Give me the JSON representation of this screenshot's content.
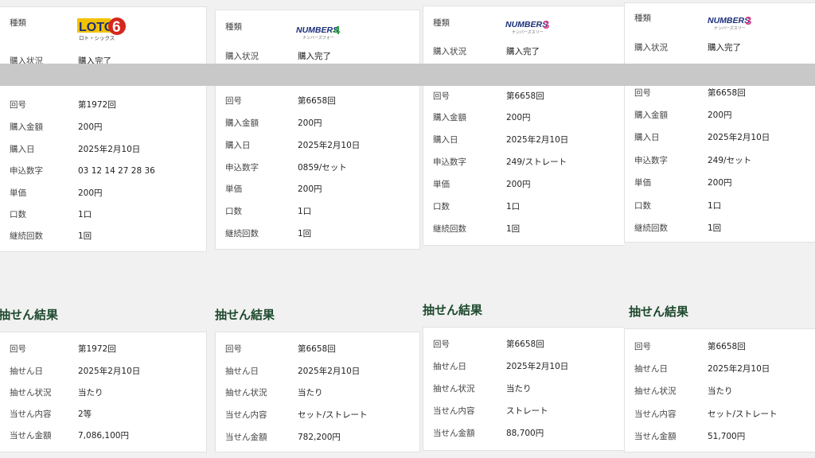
{
  "purchase_cards": [
    {
      "type_label": "種類",
      "logo": {
        "main": "LOTO",
        "num": "6",
        "sub": "ロト・シックス"
      },
      "status_label": "購入状況",
      "status_value": "購入完了",
      "rows": [
        {
          "label": "回号",
          "value": "第1972回"
        },
        {
          "label": "購入金額",
          "value": "200円"
        },
        {
          "label": "購入日",
          "value": "2025年2月10日"
        },
        {
          "label": "申込数字",
          "value": "03 12 14 27 28 36"
        },
        {
          "label": "単価",
          "value": "200円"
        },
        {
          "label": "口数",
          "value": "1口"
        },
        {
          "label": "継続回数",
          "value": "1回"
        }
      ]
    },
    {
      "type_label": "種類",
      "logo": {
        "main": "NUMBERS",
        "num": "4",
        "sub": "ナンバーズフォー"
      },
      "status_label": "購入状況",
      "status_value": "購入完了",
      "rows": [
        {
          "label": "回号",
          "value": "第6658回"
        },
        {
          "label": "購入金額",
          "value": "200円"
        },
        {
          "label": "購入日",
          "value": "2025年2月10日"
        },
        {
          "label": "申込数字",
          "value": "0859/セット"
        },
        {
          "label": "単価",
          "value": "200円"
        },
        {
          "label": "口数",
          "value": "1口"
        },
        {
          "label": "継続回数",
          "value": "1回"
        }
      ]
    },
    {
      "type_label": "種類",
      "logo": {
        "main": "NUMBERS",
        "num": "3",
        "sub": "ナンバーズスリー"
      },
      "status_label": "購入状況",
      "status_value": "購入完了",
      "rows": [
        {
          "label": "回号",
          "value": "第6658回"
        },
        {
          "label": "購入金額",
          "value": "200円"
        },
        {
          "label": "購入日",
          "value": "2025年2月10日"
        },
        {
          "label": "申込数字",
          "value": "249/ストレート"
        },
        {
          "label": "単価",
          "value": "200円"
        },
        {
          "label": "口数",
          "value": "1口"
        },
        {
          "label": "継続回数",
          "value": "1回"
        }
      ]
    },
    {
      "type_label": "種類",
      "logo": {
        "main": "NUMBERS",
        "num": "3",
        "sub": "ナンバーズスリー"
      },
      "status_label": "購入状況",
      "status_value": "購入完了",
      "rows": [
        {
          "label": "回号",
          "value": "第6658回"
        },
        {
          "label": "購入金額",
          "value": "200円"
        },
        {
          "label": "購入日",
          "value": "2025年2月10日"
        },
        {
          "label": "申込数字",
          "value": "249/セット"
        },
        {
          "label": "単価",
          "value": "200円"
        },
        {
          "label": "口数",
          "value": "1口"
        },
        {
          "label": "継続回数",
          "value": "1回"
        }
      ]
    }
  ],
  "result_sections": [
    {
      "title": "抽せん結果",
      "rows": [
        {
          "label": "回号",
          "value": "第1972回"
        },
        {
          "label": "抽せん日",
          "value": "2025年2月10日"
        },
        {
          "label": "抽せん状況",
          "value": "当たり"
        },
        {
          "label": "当せん内容",
          "value": "2等"
        },
        {
          "label": "当せん金額",
          "value": "7,086,100円"
        }
      ]
    },
    {
      "title": "抽せん結果",
      "rows": [
        {
          "label": "回号",
          "value": "第6658回"
        },
        {
          "label": "抽せん日",
          "value": "2025年2月10日"
        },
        {
          "label": "抽せん状況",
          "value": "当たり"
        },
        {
          "label": "当せん内容",
          "value": "セット/ストレート"
        },
        {
          "label": "当せん金額",
          "value": "782,200円"
        }
      ]
    },
    {
      "title": "抽せん結果",
      "rows": [
        {
          "label": "回号",
          "value": "第6658回"
        },
        {
          "label": "抽せん日",
          "value": "2025年2月10日"
        },
        {
          "label": "抽せん状況",
          "value": "当たり"
        },
        {
          "label": "当せん内容",
          "value": "ストレート"
        },
        {
          "label": "当せん金額",
          "value": "88,700円"
        }
      ]
    },
    {
      "title": "抽せん結果",
      "rows": [
        {
          "label": "回号",
          "value": "第6658回"
        },
        {
          "label": "抽せん日",
          "value": "2025年2月10日"
        },
        {
          "label": "抽せん状況",
          "value": "当たり"
        },
        {
          "label": "当せん内容",
          "value": "セット/ストレート"
        },
        {
          "label": "当せん金額",
          "value": "51,700円"
        }
      ]
    }
  ],
  "colors": {
    "title_green": "#1e4a2e",
    "loto_red": "#d6261c",
    "loto_yellow": "#f2c200",
    "numbers_purple": "#7b2a8c",
    "numbers_navy": "#1b2f7a",
    "numbers_pink": "#e23d8a"
  }
}
